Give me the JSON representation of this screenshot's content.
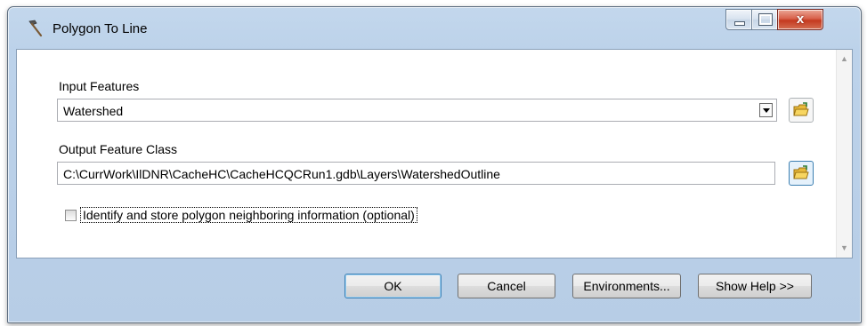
{
  "window": {
    "title": "Polygon To Line",
    "title_icon": "hammer-icon",
    "controls": {
      "minimize_icon": "minimize-icon",
      "maximize_icon": "maximize-icon",
      "close_label": "x"
    }
  },
  "form": {
    "input_features": {
      "label": "Input Features",
      "value": "Watershed",
      "browse_icon": "folder-open-icon"
    },
    "output_feature_class": {
      "label": "Output Feature Class",
      "value": "C:\\CurrWork\\IlDNR\\CacheHC\\CacheHCQCRun1.gdb\\Layers\\WatershedOutline",
      "browse_icon": "folder-open-icon"
    },
    "neighbor_option": {
      "label": "Identify and store polygon neighboring information (optional)",
      "checked": false
    }
  },
  "buttons": {
    "ok": "OK",
    "cancel": "Cancel",
    "environments": "Environments...",
    "show_help": "Show Help >>"
  }
}
